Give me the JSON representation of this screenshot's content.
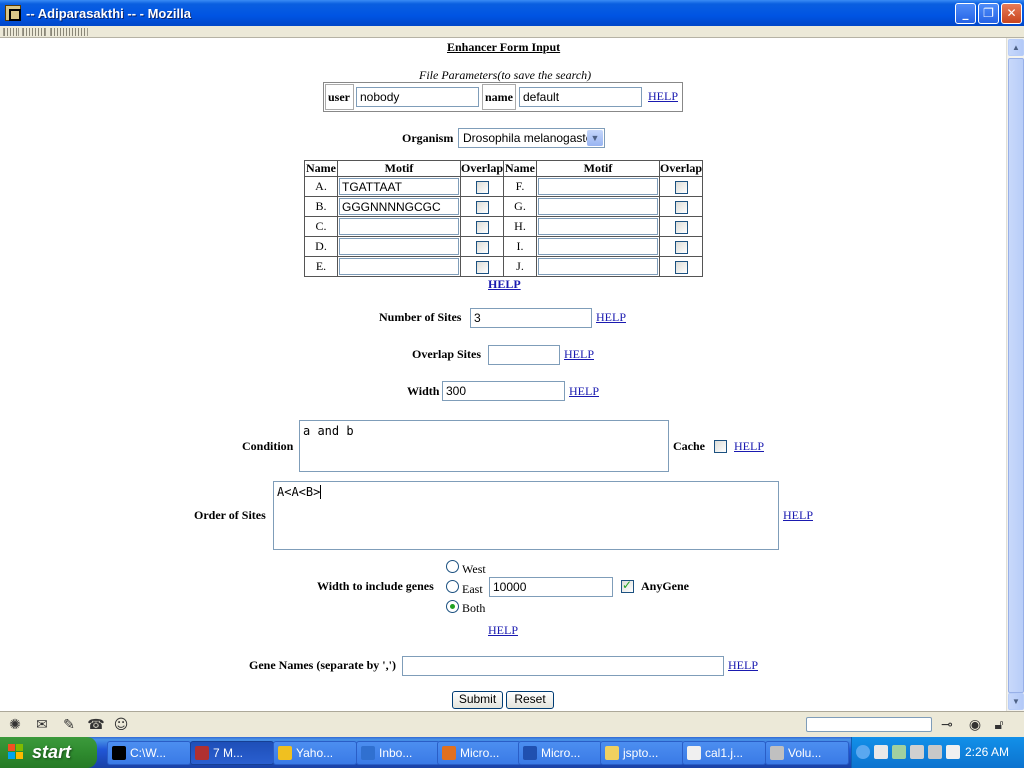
{
  "window": {
    "title": "-- Adiparasakthi -- - Mozilla",
    "minimize_glyph": "_",
    "maximize_glyph": "❐",
    "close_glyph": "✕"
  },
  "form": {
    "heading": "Enhancer Form Input",
    "file_params": {
      "caption": "File Parameters(to save the search)",
      "user_label": "user",
      "user_value": "nobody",
      "name_label": "name",
      "name_value": "default",
      "help": "HELP"
    },
    "organism": {
      "label": "Organism",
      "selected": "Drosophila melanogaster"
    },
    "motif_table": {
      "headers": [
        "Name",
        "Motif",
        "Overlap",
        "Name",
        "Motif",
        "Overlap"
      ],
      "left": [
        {
          "name": "A.",
          "motif": "TGATTAAT",
          "overlap": false
        },
        {
          "name": "B.",
          "motif": "GGGNNNNGCGC",
          "overlap": false
        },
        {
          "name": "C.",
          "motif": "",
          "overlap": false
        },
        {
          "name": "D.",
          "motif": "",
          "overlap": false
        },
        {
          "name": "E.",
          "motif": "",
          "overlap": false
        }
      ],
      "right": [
        {
          "name": "F.",
          "motif": "",
          "overlap": false
        },
        {
          "name": "G.",
          "motif": "",
          "overlap": false
        },
        {
          "name": "H.",
          "motif": "",
          "overlap": false
        },
        {
          "name": "I.",
          "motif": "",
          "overlap": false
        },
        {
          "name": "J.",
          "motif": "",
          "overlap": false
        }
      ],
      "help": "HELP"
    },
    "number_of_sites": {
      "label": "Number of Sites",
      "value": "3",
      "help": "HELP"
    },
    "overlap_sites": {
      "label": "Overlap Sites",
      "value": "",
      "help": "HELP"
    },
    "width": {
      "label": "Width",
      "value": "300",
      "help": "HELP"
    },
    "condition": {
      "label": "Condition",
      "value": "a and b"
    },
    "cache": {
      "label": "Cache",
      "checked": false,
      "help": "HELP"
    },
    "order_of_sites": {
      "label": "Order of Sites",
      "value": "A<A<B>",
      "help": "HELP"
    },
    "width_genes": {
      "label": "Width to include genes",
      "options": [
        "West",
        "East",
        "Both"
      ],
      "selected": "Both",
      "value": "10000",
      "anygene_label": "AnyGene",
      "anygene_checked": true,
      "help": "HELP"
    },
    "gene_names": {
      "label": "Gene Names (separate by ',')",
      "value": "",
      "help": "HELP"
    },
    "submit_label": "Submit",
    "reset_label": "Reset"
  },
  "statusbar": {
    "icons": [
      "navigator-icon",
      "mail-icon",
      "composer-icon",
      "addressbook-icon",
      "irc-chat-icon"
    ]
  },
  "taskbar": {
    "start_label": "start",
    "tasks": [
      {
        "label": "C:\\W...",
        "icon_color": "#000000"
      },
      {
        "label": "7 M...",
        "icon_color": "#b03030"
      },
      {
        "label": "Yaho...",
        "icon_color": "#f0c020"
      },
      {
        "label": "Inbo...",
        "icon_color": "#3070d0"
      },
      {
        "label": "Micro...",
        "icon_color": "#e07020"
      },
      {
        "label": "Micro...",
        "icon_color": "#2050b0"
      },
      {
        "label": "jspto...",
        "icon_color": "#f0d060"
      },
      {
        "label": "cal1.j...",
        "icon_color": "#f0f0f0"
      },
      {
        "label": "Volu...",
        "icon_color": "#c0c0c0"
      }
    ],
    "clock": "2:26 AM"
  }
}
